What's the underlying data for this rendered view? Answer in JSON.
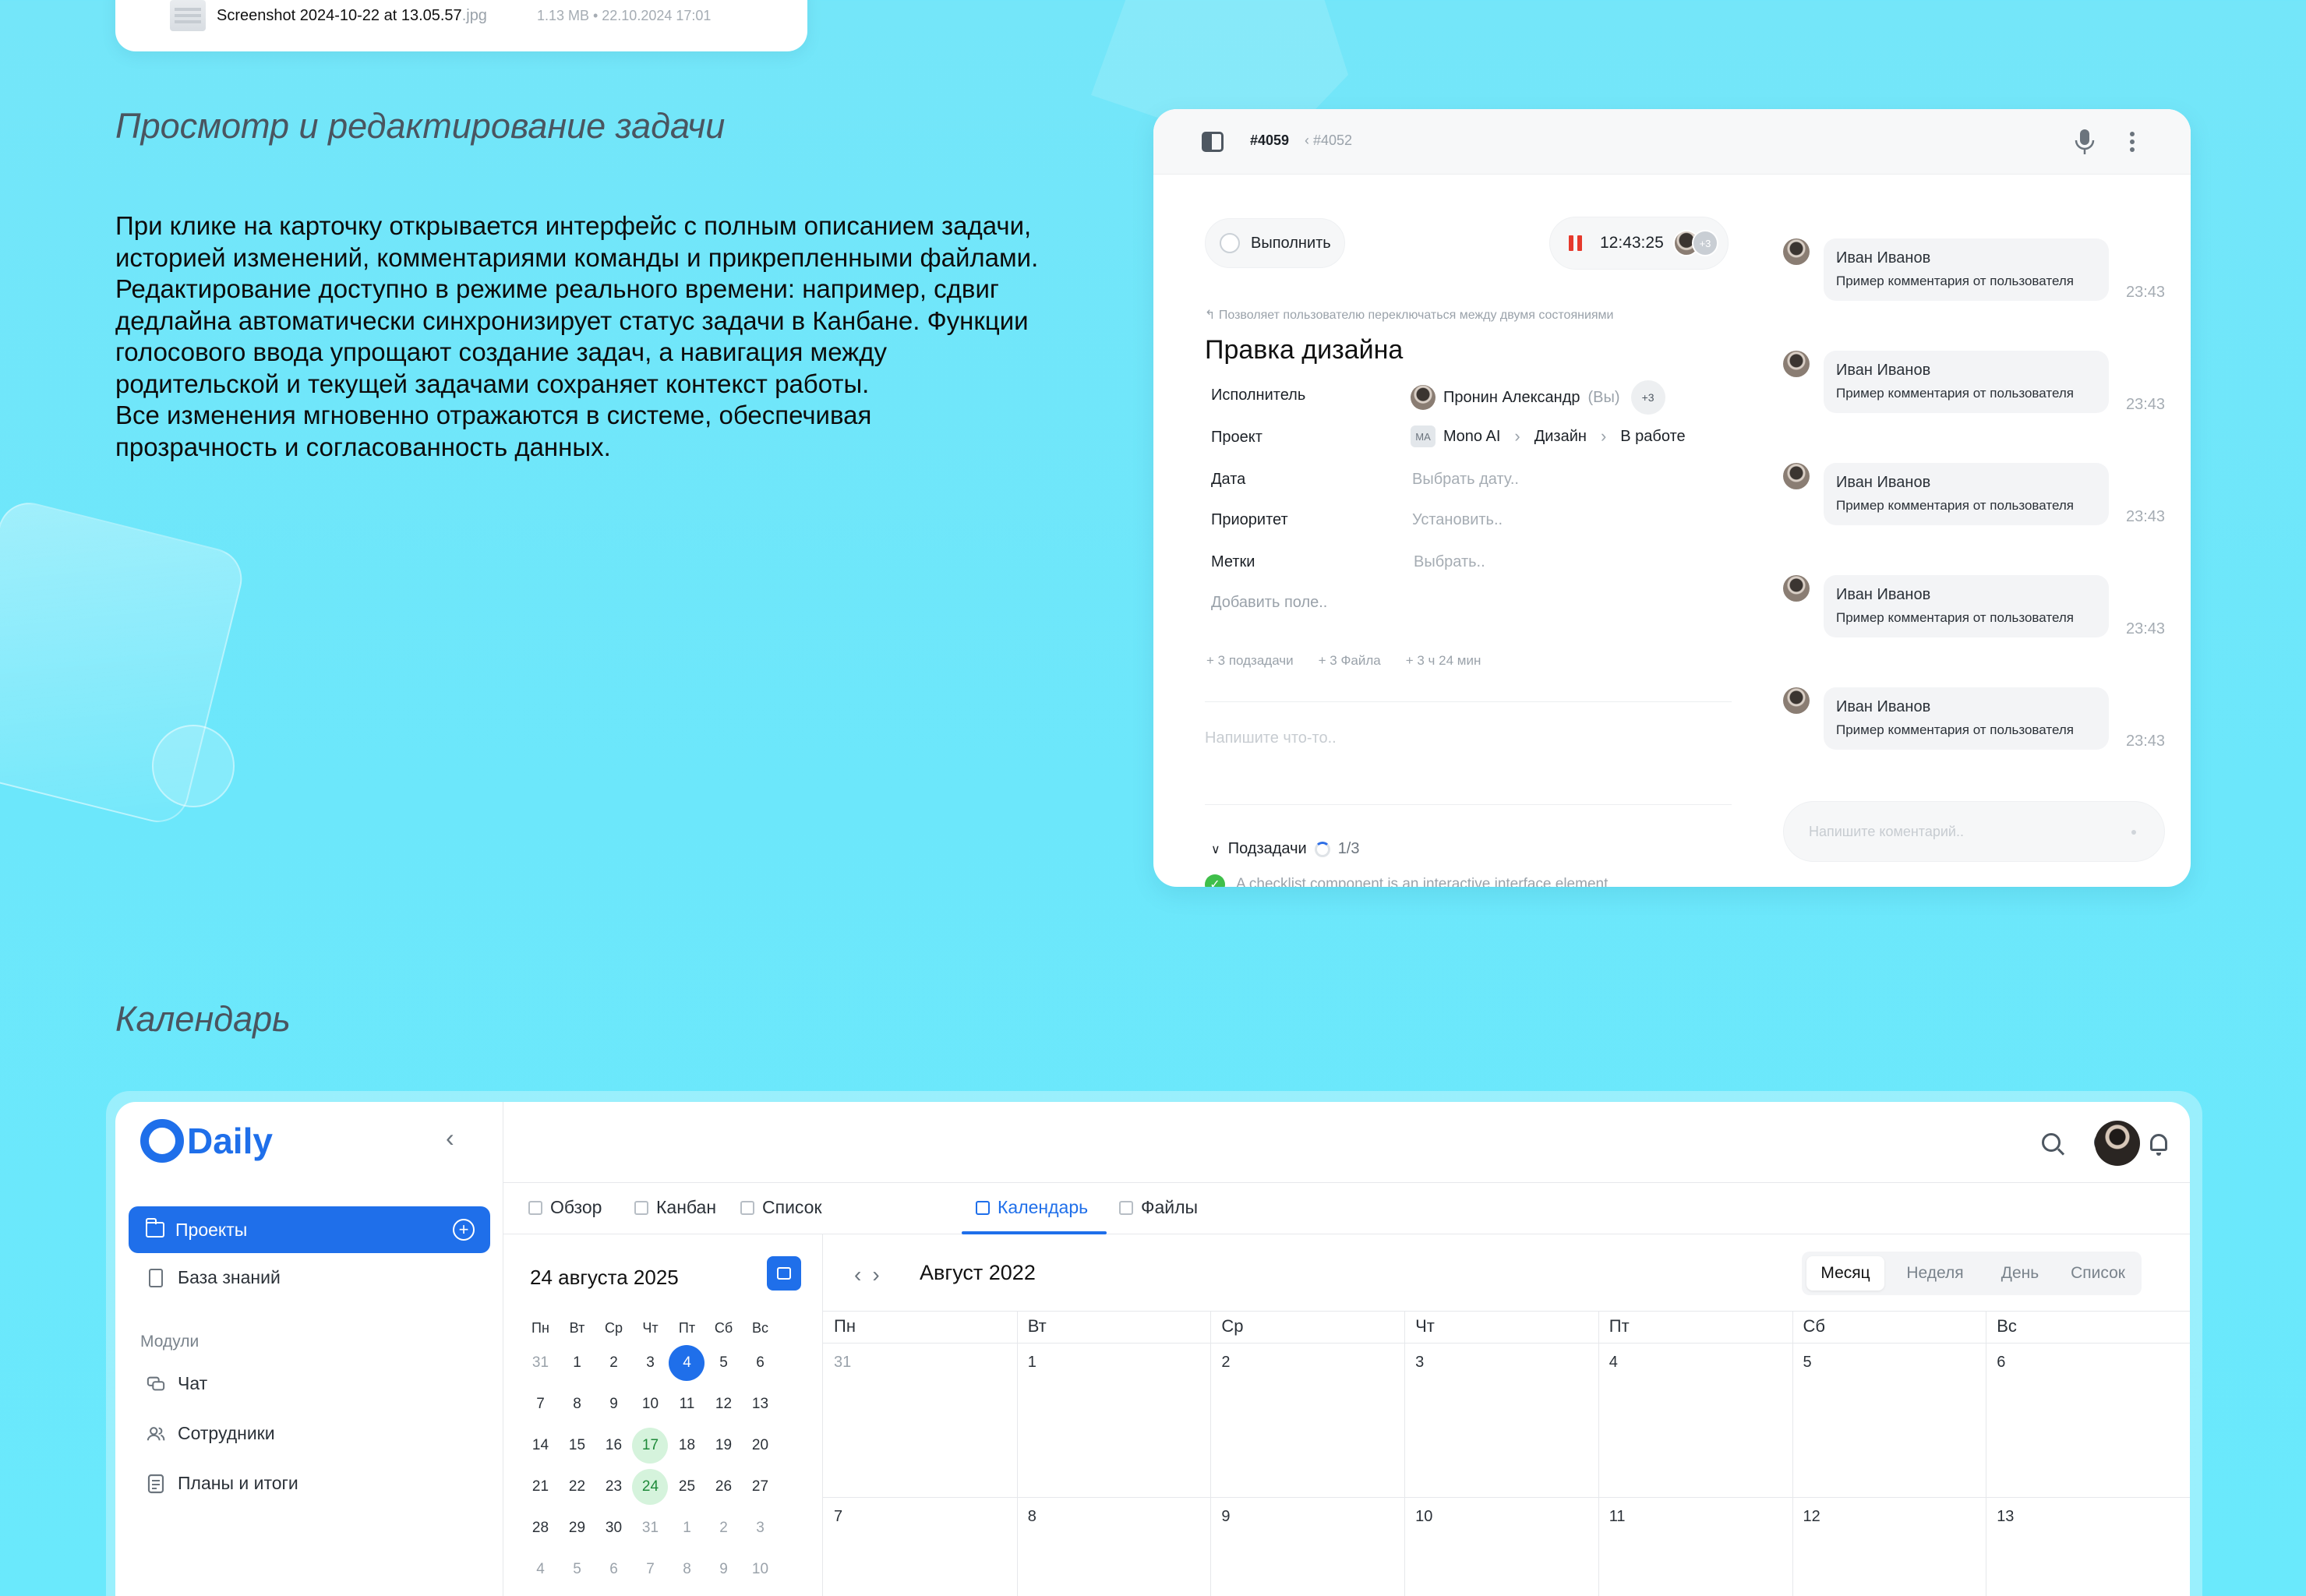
{
  "file": {
    "name": "Screenshot 2024-10-22 at 13.05.57",
    "ext": ".jpg",
    "meta": "1.13 MB • 22.10.2024 17:01"
  },
  "section1": {
    "title": "Просмотр и редактирование задачи",
    "description_lines": [
      "При клике на карточку открывается интерфейс с полным описанием задачи,",
      "историей изменений, комментариями команды и прикрепленными файлами.",
      "Редактирование доступно в режиме реального времени: например, сдвиг",
      "дедлайна автоматически синхронизирует статус задачи в Канбане. Функции",
      "голосового ввода упрощают создание задач, а навигация между",
      "родительской и текущей задачами сохраняет контекст работы.",
      "Все изменения мгновенно отражаются в системе, обеспечивая",
      "прозрачность и согласованность данных."
    ]
  },
  "task": {
    "id": "#4059",
    "parent_id": "#4052",
    "done_label": "Выполнить",
    "timer": "12:43:25",
    "timer_extra": "+3",
    "toggle_hint": "↰ Позволяет пользователю переключаться между двумя состояниями",
    "title": "Правка дизайна",
    "fields": {
      "assignee_label": "Исполнитель",
      "assignee_name": "Пронин Александр",
      "assignee_you": "(Вы)",
      "assignee_extra": "+3",
      "project_label": "Проект",
      "project_badge": "MA",
      "project_name": "Mono AI",
      "project_section": "Дизайн",
      "project_status": "В работе",
      "date_label": "Дата",
      "date_placeholder": "Выбрать дату..",
      "priority_label": "Приоритет",
      "priority_placeholder": "Установить..",
      "tags_label": "Метки",
      "tags_placeholder": "Выбрать..",
      "add_field": "Добавить поле.."
    },
    "meta": [
      "+ 3 подзадачи",
      "+ 3 Файла",
      "+ 3 ч 24 мин"
    ],
    "note_placeholder": "Напишите что-то..",
    "subtasks_label": "Подзадачи",
    "subtasks_count": "1/3",
    "checklist_item": "A checklist component is an interactive interface element",
    "comments": [
      {
        "author": "Иван Иванов",
        "text": "Пример комментария от пользователя",
        "time": "23:43"
      },
      {
        "author": "Иван Иванов",
        "text": "Пример комментария от пользователя",
        "time": "23:43"
      },
      {
        "author": "Иван Иванов",
        "text": "Пример комментария от пользователя",
        "time": "23:43"
      },
      {
        "author": "Иван Иванов",
        "text": "Пример комментария от пользователя",
        "time": "23:43"
      },
      {
        "author": "Иван Иванов",
        "text": "Пример комментария от пользователя",
        "time": "23:43"
      }
    ],
    "comment_placeholder": "Напишите коментарий.."
  },
  "section2": {
    "title": "Календарь"
  },
  "app": {
    "brand": "Daily",
    "sidebar": {
      "projects": "Проекты",
      "knowledge": "База знаний",
      "modules_label": "Модули",
      "chat": "Чат",
      "employees": "Сотрудники",
      "plans": "Планы и итоги"
    },
    "tabs": [
      "Обзор",
      "Канбан",
      "Список",
      "Календарь",
      "Файлы"
    ],
    "mini": {
      "date": "24 августа 2025",
      "weekdays": [
        "Пн",
        "Вт",
        "Ср",
        "Чт",
        "Пт",
        "Сб",
        "Вс"
      ],
      "weeks": [
        [
          "31",
          "1",
          "2",
          "3",
          "4",
          "5",
          "6"
        ],
        [
          "7",
          "8",
          "9",
          "10",
          "11",
          "12",
          "13"
        ],
        [
          "14",
          "15",
          "16",
          "17",
          "18",
          "19",
          "20"
        ],
        [
          "21",
          "22",
          "23",
          "24",
          "25",
          "26",
          "27"
        ],
        [
          "28",
          "29",
          "30",
          "31",
          "1",
          "2",
          "3"
        ],
        [
          "4",
          "5",
          "6",
          "7",
          "8",
          "9",
          "10"
        ]
      ],
      "selected": "4",
      "highlighted": [
        "17",
        "24"
      ]
    },
    "big": {
      "month": "Август 2022",
      "views": [
        "Месяц",
        "Неделя",
        "День",
        "Список"
      ],
      "active_view": "Месяц",
      "weekdays": [
        "Пн",
        "Вт",
        "Ср",
        "Чт",
        "Пт",
        "Сб",
        "Вс"
      ],
      "weeks": [
        [
          "31",
          "1",
          "2",
          "3",
          "4",
          "5",
          "6"
        ],
        [
          "7",
          "8",
          "9",
          "10",
          "11",
          "12",
          "13"
        ]
      ]
    },
    "colors": {
      "accent": "#1f6fea",
      "highlight": "#d5f3dc",
      "timer": "#e6392c"
    }
  }
}
